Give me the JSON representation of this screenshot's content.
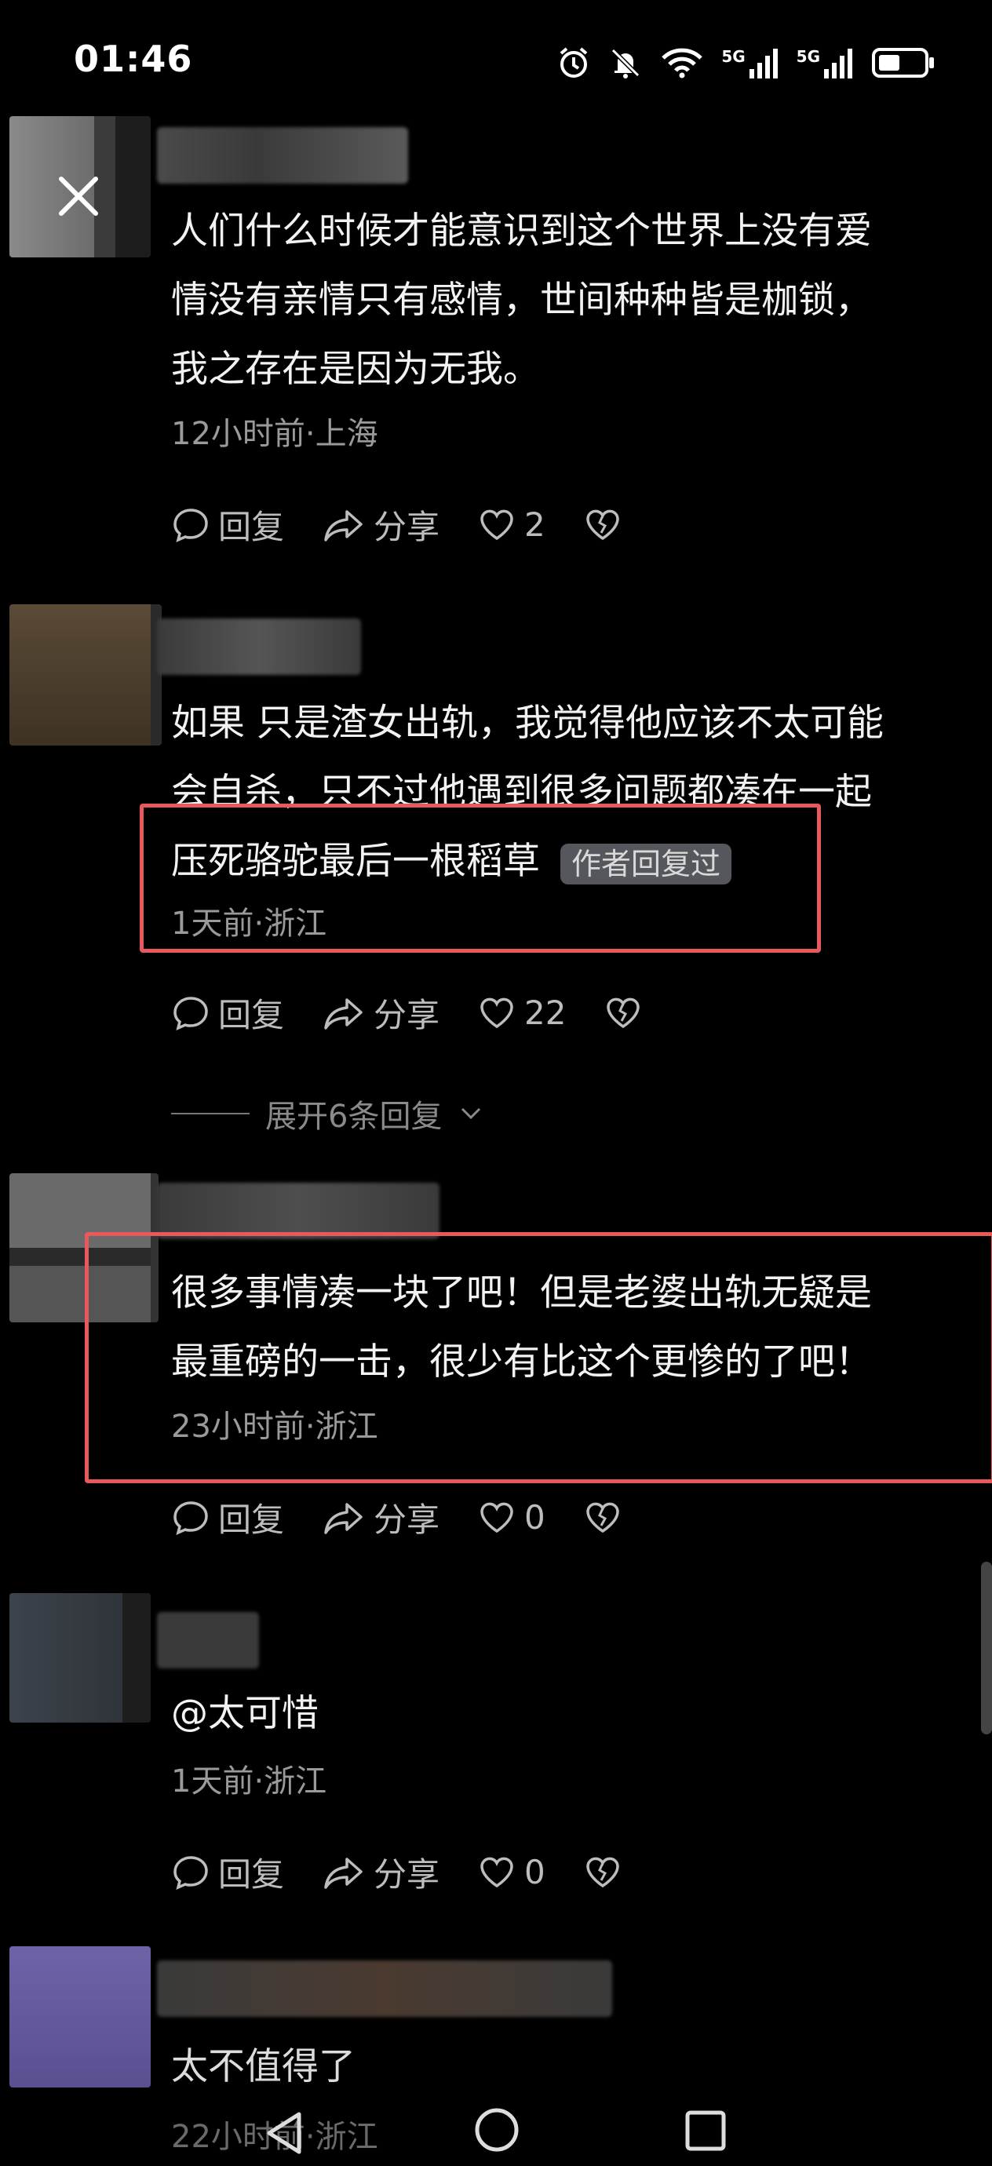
{
  "status_bar": {
    "time": "01:46",
    "icons": [
      "alarm-icon",
      "mute-icon",
      "wifi-icon",
      "5g-signal-icon",
      "5g-signal-icon",
      "battery-icon"
    ],
    "network_labels": [
      "5G",
      "5G"
    ]
  },
  "comments": [
    {
      "text": "人们什么时候才能意识到这个世界上没有爱\n情没有亲情只有感情，世间种种皆是枷锁，\n我之存在是因为无我。",
      "meta": "12小时前·上海",
      "reply_label": "回复",
      "share_label": "分享",
      "likes": "2"
    },
    {
      "text": "如果 只是渣女出轨，我觉得他应该不太可能\n会自杀，只不过他遇到很多问题都凑在一起\n压死骆驼最后一根稻草",
      "badge": "作者回复过",
      "meta": "1天前·浙江",
      "reply_label": "回复",
      "share_label": "分享",
      "likes": "22",
      "expand_label": "展开6条回复"
    },
    {
      "text": "很多事情凑一块了吧！但是老婆出轨无疑是\n最重磅的一击，很少有比这个更惨的了吧！",
      "meta": "23小时前·浙江",
      "reply_label": "回复",
      "share_label": "分享",
      "likes": "0"
    },
    {
      "text": "@太可惜",
      "meta": "1天前·浙江",
      "reply_label": "回复",
      "share_label": "分享",
      "likes": "0"
    },
    {
      "text": "太不值得了",
      "meta": "22小时前·浙江"
    }
  ],
  "colors": {
    "background": "#000000",
    "highlight_border": "#e8595d",
    "meta_text": "#9a9a9a",
    "badge_bg": "#55575c"
  }
}
